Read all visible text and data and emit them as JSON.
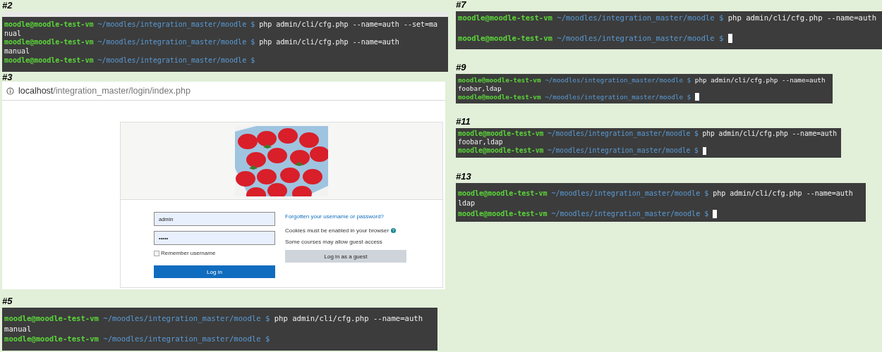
{
  "left": [
    {
      "kind": "terminal",
      "label": "#2",
      "lines": [
        {
          "kind": "prompt",
          "user": "moodle@moodle-test-vm",
          "path": "~/moodles/integration_master/moodle",
          "symbol": "$",
          "command": "php admin/cli/cfg.php --name=auth --set=ma",
          "cursor": false
        },
        {
          "kind": "output",
          "text": "nual"
        },
        {
          "kind": "prompt",
          "user": "moodle@moodle-test-vm",
          "path": "~/moodles/integration_master/moodle",
          "symbol": "$",
          "command": "php admin/cli/cfg.php --name=auth",
          "cursor": false
        },
        {
          "kind": "output",
          "text": "manual"
        },
        {
          "kind": "prompt",
          "user": "moodle@moodle-test-vm",
          "path": "~/moodles/integration_master/moodle",
          "symbol": "$",
          "cursor": false
        }
      ]
    },
    {
      "kind": "browser",
      "label": "#3",
      "url": {
        "host": "localhost",
        "path": "/integration_master/login/index.php"
      },
      "login": {
        "username": "admin",
        "password": "•••••",
        "remember": {
          "label": "Remember username",
          "checked": false
        },
        "login_button": "Log in",
        "forgot_link": "Forgotten your username or password?",
        "cookies_note": "Cookies must be enabled in your browser",
        "guest_note": "Some courses may allow guest access",
        "guest_button": "Log in as a guest"
      }
    },
    {
      "kind": "terminal",
      "label": "#5",
      "lines": [
        {
          "kind": "prompt",
          "user": "moodle@moodle-test-vm",
          "path": "~/moodles/integration_master/moodle",
          "symbol": "$",
          "command": "php admin/cli/cfg.php --name=auth",
          "cursor": false
        },
        {
          "kind": "output",
          "text": "manual"
        },
        {
          "kind": "prompt",
          "user": "moodle@moodle-test-vm",
          "path": "~/moodles/integration_master/moodle",
          "symbol": "$",
          "cursor": false
        }
      ]
    }
  ],
  "right": [
    {
      "kind": "terminal",
      "label": "#7",
      "lines": [
        {
          "kind": "prompt",
          "user": "moodle@moodle-test-vm",
          "path": "~/moodles/integration_master/moodle",
          "symbol": "$",
          "command": "php admin/cli/cfg.php --name=auth",
          "cursor": false
        },
        {
          "kind": "blank"
        },
        {
          "kind": "prompt",
          "user": "moodle@moodle-test-vm",
          "path": "~/moodles/integration_master/moodle",
          "symbol": "$",
          "cursor": true
        }
      ]
    },
    {
      "kind": "terminal",
      "label": "#9",
      "lines": [
        {
          "kind": "prompt",
          "user": "moodle@moodle-test-vm",
          "path": "~/moodles/integration_master/moodle",
          "symbol": "$",
          "command": "php admin/cli/cfg.php --name=auth",
          "cursor": false
        },
        {
          "kind": "output",
          "text": "foobar,ldap"
        },
        {
          "kind": "prompt",
          "user": "moodle@moodle-test-vm",
          "path": "~/moodles/integration_master/moodle",
          "symbol": "$",
          "cursor": true
        }
      ]
    },
    {
      "kind": "terminal",
      "label": "#11",
      "lines": [
        {
          "kind": "prompt",
          "user": "moodle@moodle-test-vm",
          "path": "~/moodles/integration_master/moodle",
          "symbol": "$",
          "command": "php admin/cli/cfg.php --name=auth",
          "cursor": false
        },
        {
          "kind": "output",
          "text": "foobar,ldap"
        },
        {
          "kind": "prompt",
          "user": "moodle@moodle-test-vm",
          "path": "~/moodles/integration_master/moodle",
          "symbol": "$",
          "cursor": true
        }
      ]
    },
    {
      "kind": "terminal",
      "label": "#13",
      "lines": [
        {
          "kind": "prompt",
          "user": "moodle@moodle-test-vm",
          "path": "~/moodles/integration_master/moodle",
          "symbol": "$",
          "command": "php admin/cli/cfg.php --name=auth",
          "cursor": false
        },
        {
          "kind": "output",
          "text": "ldap"
        },
        {
          "kind": "prompt",
          "user": "moodle@moodle-test-vm",
          "path": "~/moodles/integration_master/moodle",
          "symbol": "$",
          "cursor": true
        }
      ]
    }
  ]
}
